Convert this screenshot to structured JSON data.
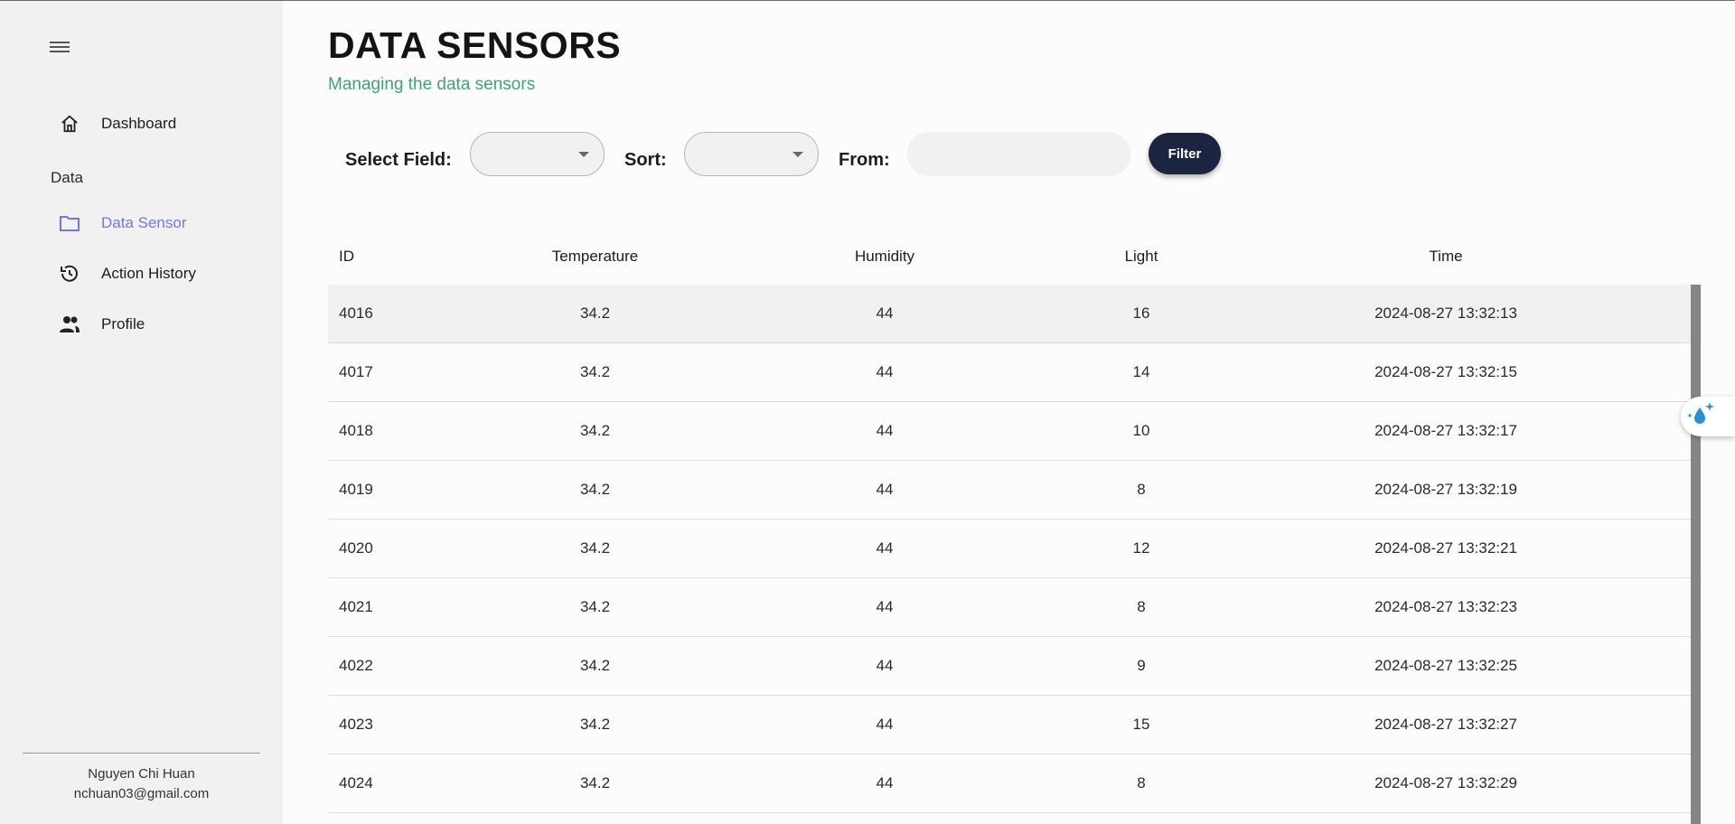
{
  "sidebar": {
    "items": [
      {
        "label": "Dashboard",
        "icon": "home-icon"
      },
      {
        "label": "Data Sensor",
        "icon": "folder-icon"
      },
      {
        "label": "Action History",
        "icon": "history-icon"
      },
      {
        "label": "Profile",
        "icon": "people-icon"
      }
    ],
    "section_label": "Data",
    "user": {
      "name": "Nguyen Chi Huan",
      "email": "nchuan03@gmail.com"
    }
  },
  "header": {
    "title": "DATA SENSORS",
    "subtitle": "Managing the data sensors"
  },
  "filters": {
    "select_field_label": "Select Field:",
    "select_field_value": "",
    "sort_label": "Sort:",
    "sort_value": "",
    "from_label": "From:",
    "from_value": "",
    "filter_button": "Filter"
  },
  "table": {
    "columns": [
      "ID",
      "Temperature",
      "Humidity",
      "Light",
      "Time"
    ],
    "rows": [
      [
        "4016",
        "34.2",
        "44",
        "16",
        "2024-08-27 13:32:13"
      ],
      [
        "4017",
        "34.2",
        "44",
        "14",
        "2024-08-27 13:32:15"
      ],
      [
        "4018",
        "34.2",
        "44",
        "10",
        "2024-08-27 13:32:17"
      ],
      [
        "4019",
        "34.2",
        "44",
        "8",
        "2024-08-27 13:32:19"
      ],
      [
        "4020",
        "34.2",
        "44",
        "12",
        "2024-08-27 13:32:21"
      ],
      [
        "4021",
        "34.2",
        "44",
        "8",
        "2024-08-27 13:32:23"
      ],
      [
        "4022",
        "34.2",
        "44",
        "9",
        "2024-08-27 13:32:25"
      ],
      [
        "4023",
        "34.2",
        "44",
        "15",
        "2024-08-27 13:32:27"
      ],
      [
        "4024",
        "34.2",
        "44",
        "8",
        "2024-08-27 13:32:29"
      ]
    ]
  },
  "colors": {
    "accent": "#6d78e8",
    "subtitle": "#3ea37c",
    "button": "#1c2540",
    "sidebar_bg": "#f2f0f0"
  }
}
